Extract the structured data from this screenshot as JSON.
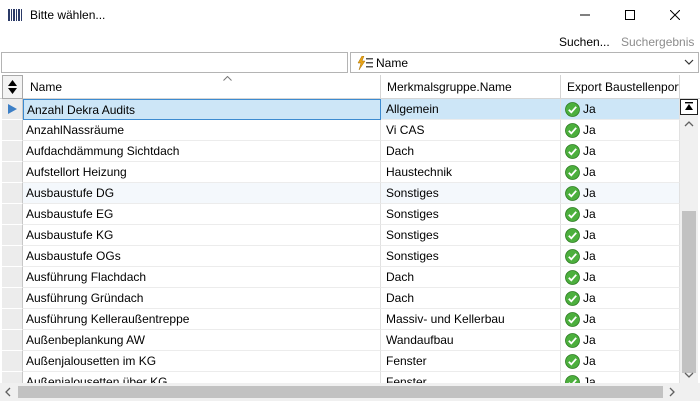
{
  "window": {
    "title": "Bitte wählen...",
    "icon": "barcode-app-icon"
  },
  "actions": {
    "search_label": "Suchen...",
    "search_result_label": "Suchergebnis"
  },
  "filter": {
    "field_value": "Name"
  },
  "table": {
    "columns": {
      "name": "Name",
      "group": "Merkmalsgruppe.Name",
      "export": "Export Baustellenportal"
    },
    "rows": [
      {
        "name": "Anzahl Dekra Audits",
        "group": "Allgemein",
        "export": "Ja"
      },
      {
        "name": "AnzahlNassräume",
        "group": "Vi CAS",
        "export": "Ja"
      },
      {
        "name": "Aufdachdämmung Sichtdach",
        "group": "Dach",
        "export": "Ja"
      },
      {
        "name": "Aufstellort Heizung",
        "group": "Haustechnik",
        "export": "Ja"
      },
      {
        "name": "Ausbaustufe DG",
        "group": "Sonstiges",
        "export": "Ja"
      },
      {
        "name": "Ausbaustufe EG",
        "group": "Sonstiges",
        "export": "Ja"
      },
      {
        "name": "Ausbaustufe KG",
        "group": "Sonstiges",
        "export": "Ja"
      },
      {
        "name": "Ausbaustufe OGs",
        "group": "Sonstiges",
        "export": "Ja"
      },
      {
        "name": "Ausführung Flachdach",
        "group": "Dach",
        "export": "Ja"
      },
      {
        "name": "Ausführung Gründach",
        "group": "Dach",
        "export": "Ja"
      },
      {
        "name": "Ausführung Kelleraußentreppe",
        "group": "Massiv- und Kellerbau",
        "export": "Ja"
      },
      {
        "name": "Außenbeplankung AW",
        "group": "Wandaufbau",
        "export": "Ja"
      },
      {
        "name": "Außenjalousetten im KG",
        "group": "Fenster",
        "export": "Ja"
      },
      {
        "name": "Außenjalousetten über KG",
        "group": "Fenster",
        "export": "Ja"
      }
    ],
    "selected_index": 0,
    "highlight_index": 4
  },
  "colors": {
    "selection": "#cde6f7",
    "selection_border": "#3d8bd0",
    "check_green": "#4caf3d",
    "muted_text": "#8c8c8c"
  }
}
